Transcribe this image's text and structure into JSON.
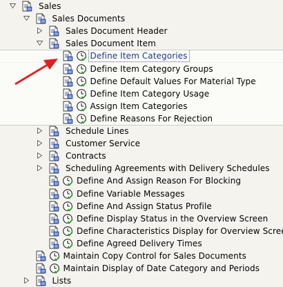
{
  "colors": {
    "background": "#f4f3ee",
    "arrow": "#e02020",
    "selected_text": "#1c3a8a"
  },
  "tree": [
    {
      "label": "Sales",
      "level": 0,
      "toggle": "expanded",
      "clock": false
    },
    {
      "label": "Sales Documents",
      "level": 1,
      "toggle": "expanded",
      "clock": false
    },
    {
      "label": "Sales Document Header",
      "level": 2,
      "toggle": "collapsed",
      "clock": false
    },
    {
      "label": "Sales Document Item",
      "level": 2,
      "toggle": "expanded",
      "clock": false
    },
    {
      "label": "Define Item Categories",
      "level": 3,
      "toggle": "none",
      "clock": true,
      "selected": true
    },
    {
      "label": "Define Item Category Groups",
      "level": 3,
      "toggle": "none",
      "clock": true
    },
    {
      "label": "Define Default Values For Material Type",
      "level": 3,
      "toggle": "none",
      "clock": true
    },
    {
      "label": "Define Item Category Usage",
      "level": 3,
      "toggle": "none",
      "clock": true
    },
    {
      "label": "Assign Item Categories",
      "level": 3,
      "toggle": "none",
      "clock": true
    },
    {
      "label": "Define Reasons For Rejection",
      "level": 3,
      "toggle": "none",
      "clock": true
    },
    {
      "label": "Schedule Lines",
      "level": 2,
      "toggle": "collapsed",
      "clock": false
    },
    {
      "label": "Customer Service",
      "level": 2,
      "toggle": "collapsed",
      "clock": false
    },
    {
      "label": "Contracts",
      "level": 2,
      "toggle": "collapsed",
      "clock": false
    },
    {
      "label": "Scheduling Agreements with Delivery Schedules",
      "level": 2,
      "toggle": "collapsed",
      "clock": false
    },
    {
      "label": "Define And Assign Reason For Blocking",
      "level": 2,
      "toggle": "none",
      "clock": true
    },
    {
      "label": "Define Variable Messages",
      "level": 2,
      "toggle": "none",
      "clock": true
    },
    {
      "label": "Define And Assign Status Profile",
      "level": 2,
      "toggle": "none",
      "clock": true
    },
    {
      "label": "Define Display Status in the Overview Screen",
      "level": 2,
      "toggle": "none",
      "clock": true
    },
    {
      "label": "Define Characteristics Display for Overview Screen",
      "level": 2,
      "toggle": "none",
      "clock": true
    },
    {
      "label": "Define Agreed Delivery Times",
      "level": 2,
      "toggle": "none",
      "clock": true
    },
    {
      "label": "Maintain Copy Control for Sales Documents",
      "level": 1,
      "toggle": "none",
      "clock": true
    },
    {
      "label": "Maintain Display of Date Category and Periods",
      "level": 1,
      "toggle": "none",
      "clock": true
    },
    {
      "label": "Lists",
      "level": 1,
      "toggle": "collapsed",
      "clock": false
    }
  ]
}
